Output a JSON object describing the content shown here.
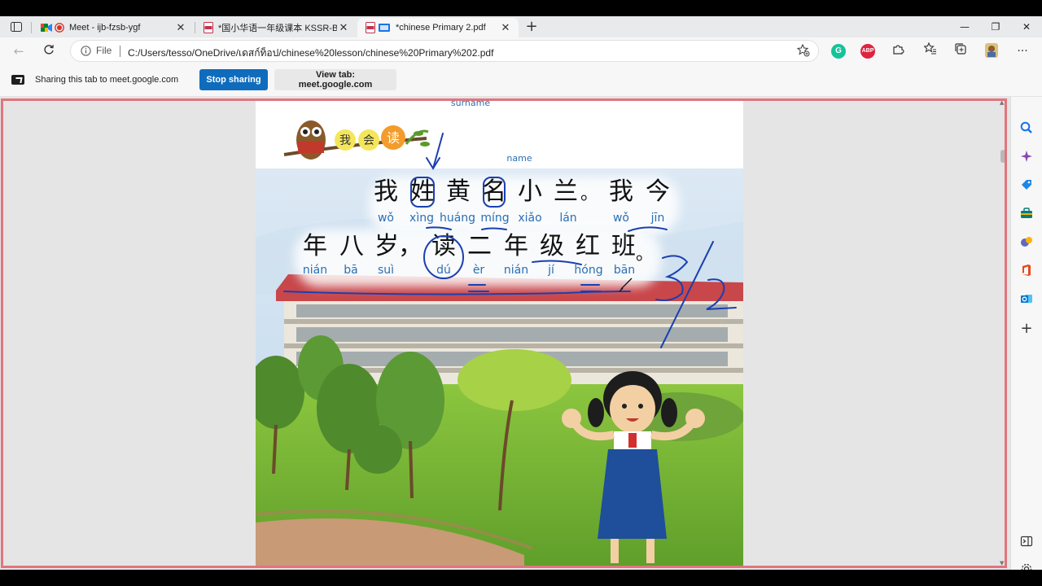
{
  "tabs": [
    {
      "label": "Meet - ijb-fzsb-ygf",
      "icon": "meet-icon"
    },
    {
      "label": "*国小华语一年级课本 KSSR-Baha",
      "icon": "pdf-icon"
    },
    {
      "label": "*chinese Primary 2.pdf",
      "icon": "pdf-icon"
    }
  ],
  "window_controls": {
    "minimize": "—",
    "maximize": "❐",
    "close": "✕"
  },
  "address": {
    "scheme_label": "File",
    "url": "C:/Users/tesso/OneDrive/เดสก์ท็อป/chinese%20lesson/chinese%20Primary%202.pdf"
  },
  "extensions": [
    {
      "name": "grammarly-icon",
      "label": "G",
      "color": "#15c39a"
    },
    {
      "name": "adblock-icon",
      "label": "ABP",
      "color": "#e0233f"
    }
  ],
  "sharebar": {
    "message": "Sharing this tab to meet.google.com",
    "stop_label": "Stop sharing",
    "view_label": "View tab: meet.google.com"
  },
  "page": {
    "annotations": {
      "surname": "surname",
      "name": "name"
    },
    "logo_chars": [
      "我",
      "会",
      "读"
    ],
    "line1_chars": [
      "我",
      "姓",
      "黄",
      "名",
      "小",
      "兰",
      "。",
      "我",
      "今"
    ],
    "line1_pinyin": [
      "wǒ",
      "xìng",
      "huáng",
      "míng",
      "xiǎo",
      "lán",
      "wǒ",
      "jīn"
    ],
    "line2_chars": [
      "年",
      "八",
      "岁",
      "，",
      "读",
      "二",
      "年",
      "级",
      "红",
      "班",
      "。"
    ],
    "line2_pinyin": [
      "nián",
      "bā",
      "suì",
      "dú",
      "èr",
      "nián",
      "jí",
      "hóng",
      "bān"
    ],
    "handwritten": "3/2"
  },
  "colors": {
    "accent": "#0f6cbd",
    "share_border": "#e2747e",
    "ink": "#1a3fb0",
    "pinyin": "#2a6fb3"
  }
}
